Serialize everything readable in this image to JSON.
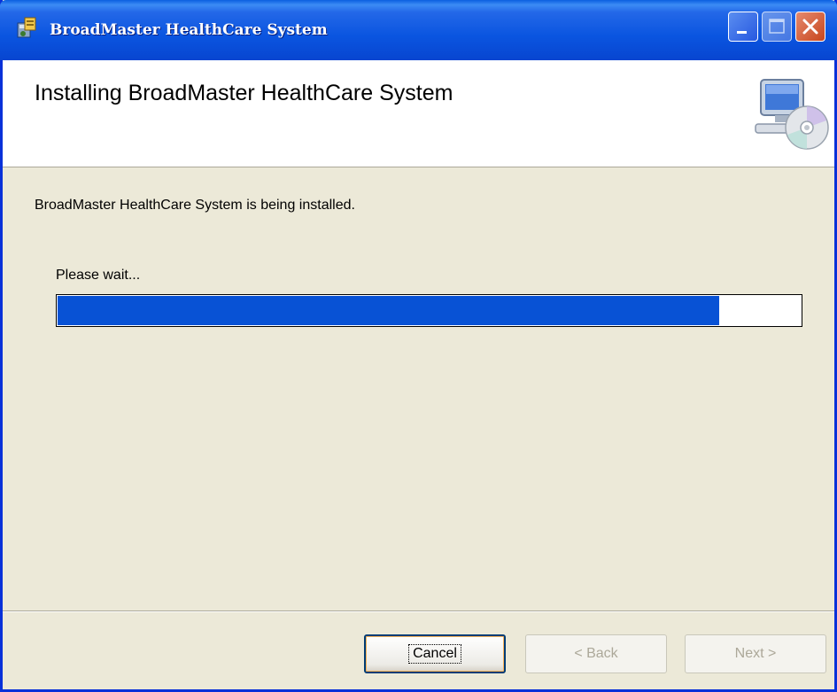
{
  "window": {
    "title": "BroadMaster HealthCare System",
    "controls": {
      "minimize": "minimize-icon",
      "maximize": "maximize-icon",
      "close": "close-icon"
    }
  },
  "header": {
    "title": "Installing BroadMaster HealthCare System",
    "icon": "computer-cd-icon"
  },
  "body": {
    "status_text": "BroadMaster HealthCare System is being installed.",
    "wait_label": "Please wait...",
    "progress_percent": 89
  },
  "footer": {
    "cancel_label": "Cancel",
    "back_label": "< Back",
    "next_label": "Next >"
  },
  "colors": {
    "titlebar": "#0A55E0",
    "progress_fill": "#0852D5",
    "dialog_bg": "#ECE9D8"
  }
}
